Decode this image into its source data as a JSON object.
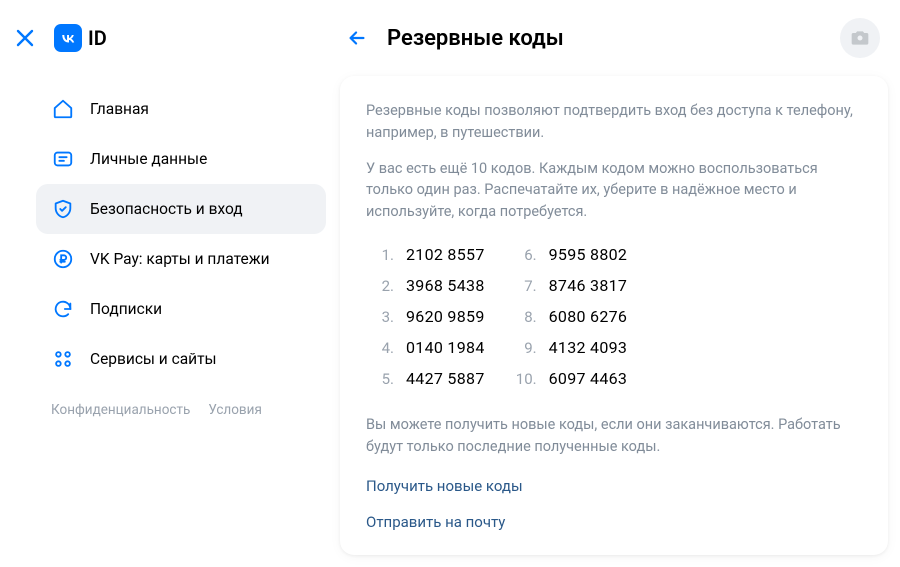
{
  "header": {
    "brand_id": "ID",
    "title": "Резервные коды"
  },
  "sidebar": {
    "items": [
      {
        "label": "Главная"
      },
      {
        "label": "Личные данные"
      },
      {
        "label": "Безопасность и вход"
      },
      {
        "label": "VK Pay: карты и платежи"
      },
      {
        "label": "Подписки"
      },
      {
        "label": "Сервисы и сайты"
      }
    ],
    "footer": {
      "privacy": "Конфиденциальность",
      "terms": "Условия"
    }
  },
  "main": {
    "desc1": "Резервные коды позволяют подтвердить вход без доступа к телефону, например, в путешествии.",
    "desc2": "У вас есть ещё 10 кодов. Каждым кодом можно воспользоваться только один раз. Распечатайте их, уберите в надёжное место и используйте, когда потребуется.",
    "codes": [
      "2102 8557",
      "3968 5438",
      "9620 9859",
      "0140 1984",
      "4427 5887",
      "9595 8802",
      "8746 3817",
      "6080 6276",
      "4132 4093",
      "6097 4463"
    ],
    "note": "Вы можете получить новые коды, если они заканчиваются. Работать будут только последние полученные коды.",
    "action_new": "Получить новые коды",
    "action_email": "Отправить на почту"
  }
}
